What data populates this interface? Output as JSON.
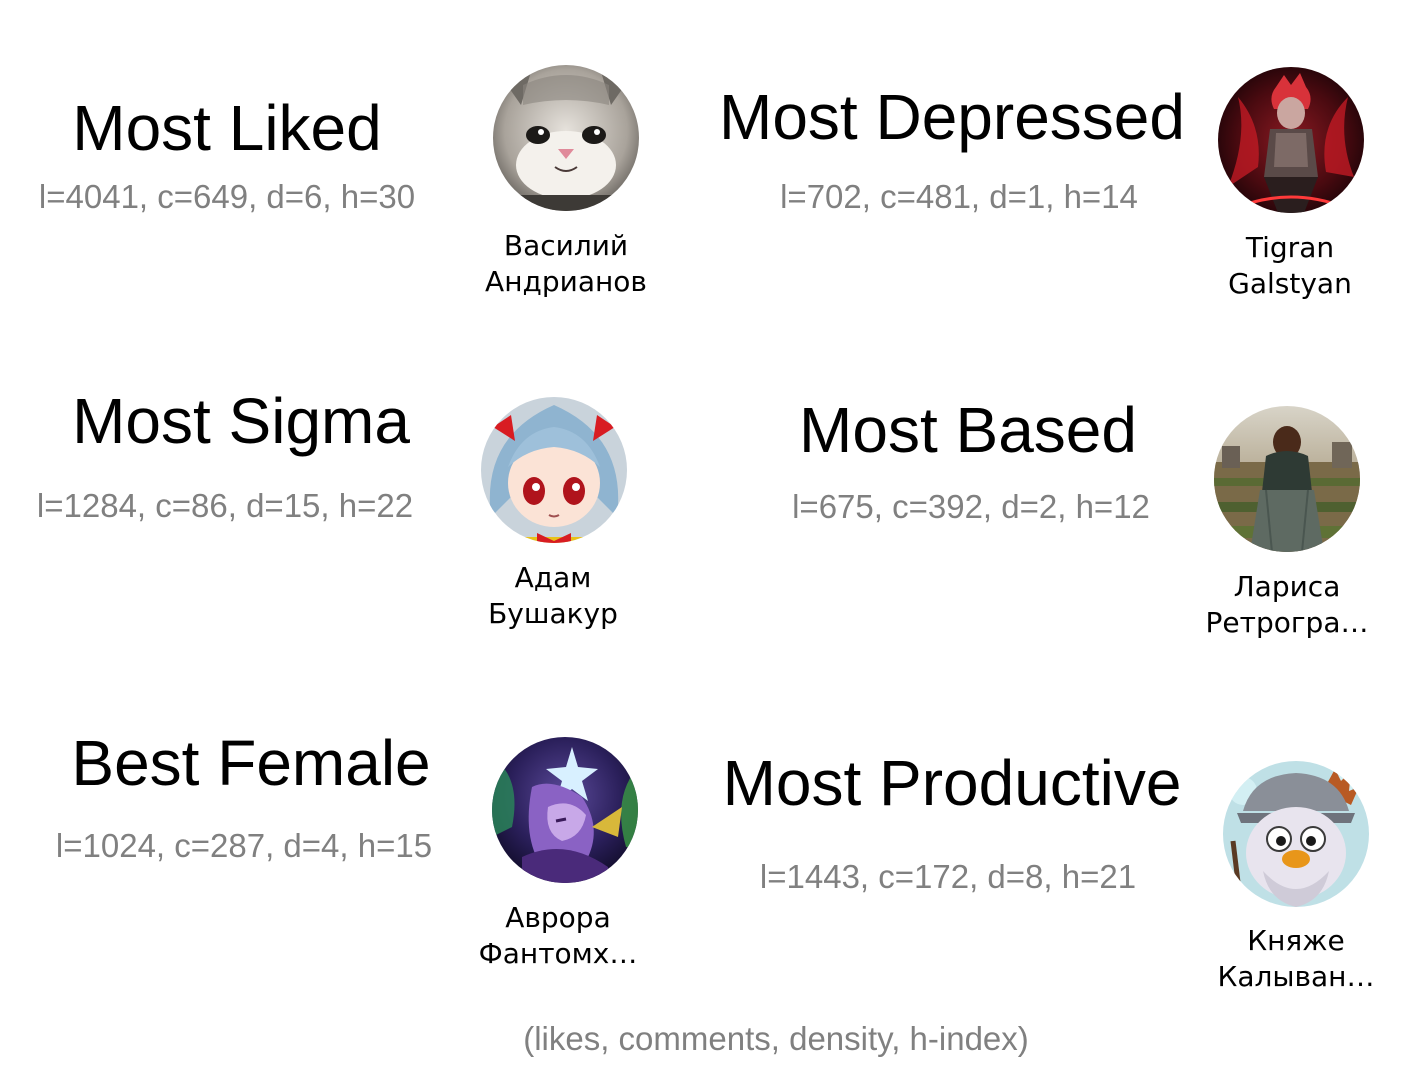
{
  "awards": [
    {
      "title": "Most Liked",
      "stats": "l=4041, c=649, d=6, h=30",
      "name_line1": "Василий",
      "name_line2": "Андрианов",
      "avatar_icon": "cat-photo-avatar"
    },
    {
      "title": "Most Depressed",
      "stats": "l=702, c=481, d=1, h=14",
      "name_line1": "Tigran",
      "name_line2": "Galstyan",
      "avatar_icon": "anime-warrior-red-avatar"
    },
    {
      "title": "Most Sigma",
      "stats": "l=1284, c=86, d=15, h=22",
      "name_line1": "Адам",
      "name_line2": "Бушакур",
      "avatar_icon": "anime-figure-blue-hair-avatar"
    },
    {
      "title": "Most Based",
      "stats": "l=675, c=392, d=2, h=12",
      "name_line1": "Лариса",
      "name_line2": "Ретрогра…",
      "avatar_icon": "person-in-garden-avatar"
    },
    {
      "title": "Best Female",
      "stats": "l=1024, c=287, d=4, h=15",
      "name_line1": "Аврора",
      "name_line2": "Фантомх…",
      "avatar_icon": "fantasy-character-purple-avatar"
    },
    {
      "title": "Most Productive",
      "stats": "l=1443, c=172, d=8, h=21",
      "name_line1": "Княже",
      "name_line2": "Калыван…",
      "avatar_icon": "cartoon-wizard-elk-avatar"
    }
  ],
  "footer": "(likes, comments, density, h-index)"
}
